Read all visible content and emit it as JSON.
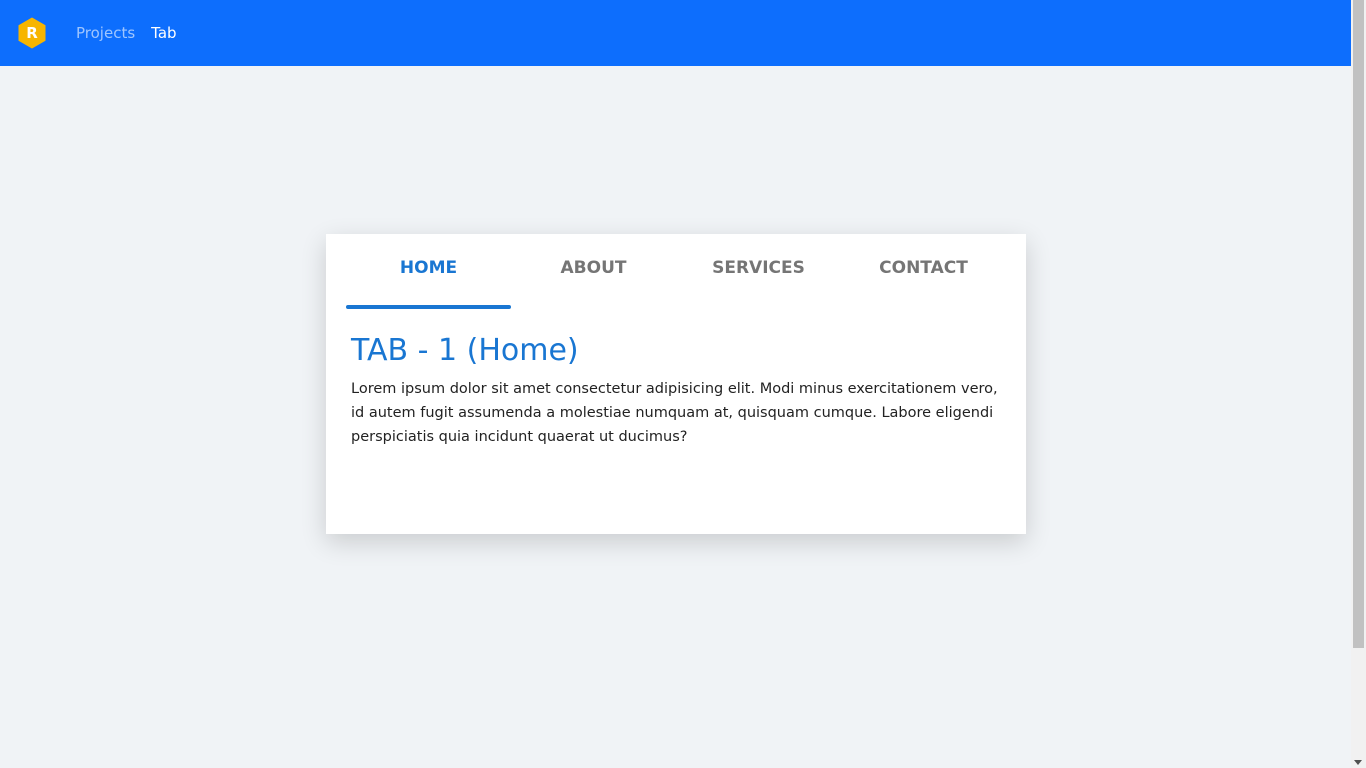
{
  "navbar": {
    "logo_letter": "R",
    "logo_color": "#f7b500",
    "background_color": "#0d6efd",
    "links": [
      {
        "label": "Projects",
        "active": false
      },
      {
        "label": "Tab",
        "active": true
      }
    ]
  },
  "tabs": {
    "items": [
      {
        "label": "HOME",
        "active": true
      },
      {
        "label": "ABOUT",
        "active": false
      },
      {
        "label": "SERVICES",
        "active": false
      },
      {
        "label": "CONTACT",
        "active": false
      }
    ],
    "accent_color": "#1976d2"
  },
  "content": {
    "heading": "TAB - 1 (Home)",
    "paragraph": "Lorem ipsum dolor sit amet consectetur adipisicing elit. Modi minus exercitationem vero, id autem fugit assumenda a molestiae numquam at, quisquam cumque. Labore eligendi perspiciatis quia incidunt quaerat ut ducimus?"
  }
}
